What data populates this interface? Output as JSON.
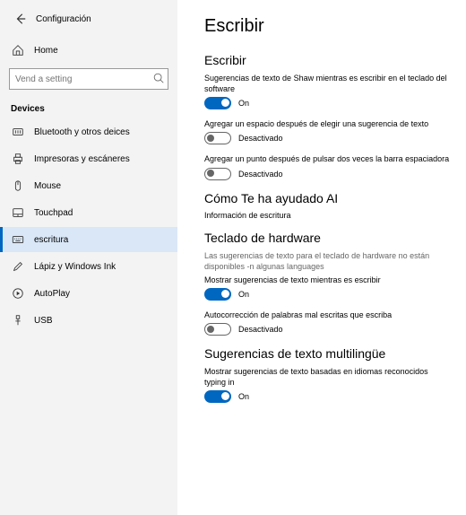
{
  "header": {
    "title": "Configuración"
  },
  "sidebar": {
    "home_label": "Home",
    "search_placeholder": "Vend a setting",
    "devices_heading": "Devices",
    "items": [
      {
        "label": "Bluetooth y otros deices"
      },
      {
        "label": "Impresoras y escáneres"
      },
      {
        "label": "Mouse"
      },
      {
        "label": "Touchpad"
      },
      {
        "label": "escritura"
      },
      {
        "label": "Lápiz y Windows Ink"
      },
      {
        "label": "AutoPlay"
      },
      {
        "label": "USB"
      }
    ]
  },
  "main": {
    "page_title": "Escribir",
    "sections": {
      "escribir": {
        "heading": "Escribir",
        "settings": [
          {
            "label": "Sugerencias de texto de Shaw mientras es escribir en el teclado del software",
            "state": "On",
            "on": true
          },
          {
            "label": "Agregar un espacio después de elegir una sugerencia de texto",
            "state": "Desactivado",
            "on": false
          },
          {
            "label": "Agregar un punto después de pulsar dos veces la barra espaciadora",
            "state": "Desactivado",
            "on": false
          }
        ]
      },
      "ai": {
        "heading": "Cómo Te ha ayudado AI",
        "link": "Información de escritura"
      },
      "hardware": {
        "heading": "Teclado de hardware",
        "note": "Las sugerencias de texto para el teclado de hardware no están disponibles -n algunas languages",
        "settings": [
          {
            "label": "Mostrar sugerencias de texto mientras es escribir",
            "state": "On",
            "on": true
          },
          {
            "label": "Autocorrección de palabras mal escritas que escriba",
            "state": "Desactivado",
            "on": false
          }
        ]
      },
      "multi": {
        "heading": "Sugerencias de texto multilingüe",
        "settings": [
          {
            "label": "Mostrar sugerencias de texto basadas en idiomas reconocidos typing in",
            "state": "On",
            "on": true
          }
        ]
      }
    }
  }
}
